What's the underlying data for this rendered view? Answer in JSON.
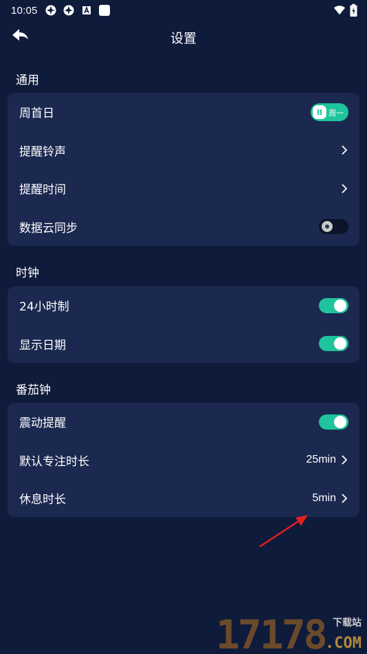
{
  "status_bar": {
    "time": "10:05",
    "left_icons": [
      "app-icon",
      "app-icon",
      "a-icon",
      "square-icon"
    ],
    "right_icons": [
      "wifi-icon",
      "battery-icon"
    ]
  },
  "header": {
    "title": "设置",
    "back_icon": "back-arrow-icon"
  },
  "sections": {
    "general": {
      "title": "通用",
      "items": [
        {
          "label": "周首日",
          "control": "week-toggle",
          "value": "周一"
        },
        {
          "label": "提醒铃声",
          "control": "chevron"
        },
        {
          "label": "提醒时间",
          "control": "chevron"
        },
        {
          "label": "数据云同步",
          "control": "toggle",
          "state": "off"
        }
      ]
    },
    "clock": {
      "title": "时钟",
      "items": [
        {
          "label": "24小时制",
          "control": "toggle",
          "state": "on"
        },
        {
          "label": "显示日期",
          "control": "toggle",
          "state": "on"
        }
      ]
    },
    "pomodoro": {
      "title": "番茄钟",
      "items": [
        {
          "label": "震动提醒",
          "control": "toggle",
          "state": "on"
        },
        {
          "label": "默认专注时长",
          "control": "chevron",
          "value": "25min"
        },
        {
          "label": "休息时长",
          "control": "chevron",
          "value": "5min"
        }
      ]
    }
  },
  "watermark": {
    "digits": "17178",
    "site": "下载站",
    "com": ".COM"
  },
  "colors": {
    "background": "#0f1b3b",
    "card": "#1b2950",
    "accent": "#1fc49c",
    "annotation_arrow": "#e02020"
  }
}
